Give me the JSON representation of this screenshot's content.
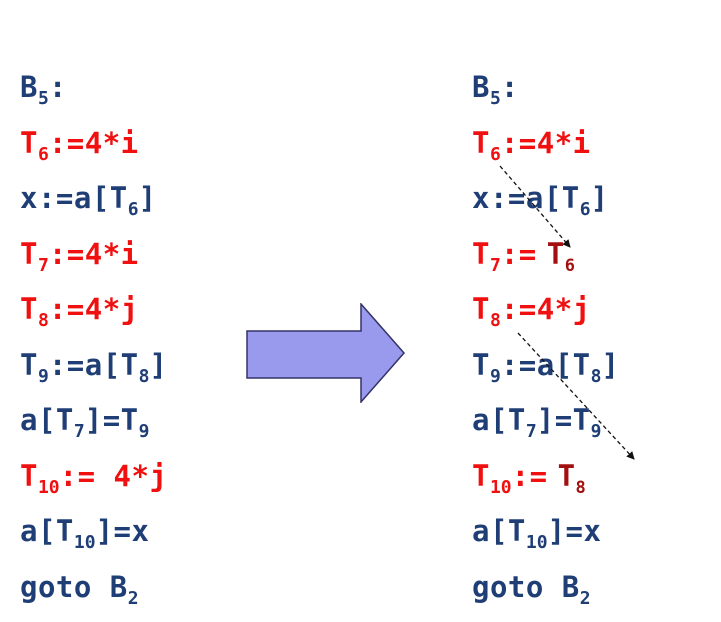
{
  "before": {
    "block_label": {
      "text": "B",
      "sub": "5",
      "suffix": ":"
    },
    "lines": [
      {
        "color": "red",
        "parts": [
          {
            "t": "T"
          },
          {
            "s": "6"
          },
          {
            "t": ":=4*i"
          }
        ]
      },
      {
        "color": "blue",
        "parts": [
          {
            "t": "x:=a[T"
          },
          {
            "s": "6"
          },
          {
            "t": "]"
          }
        ]
      },
      {
        "color": "red",
        "parts": [
          {
            "t": "T"
          },
          {
            "s": "7"
          },
          {
            "t": ":=4*i"
          }
        ]
      },
      {
        "color": "red",
        "parts": [
          {
            "t": "T"
          },
          {
            "s": "8"
          },
          {
            "t": ":=4*j"
          }
        ]
      },
      {
        "color": "blue",
        "parts": [
          {
            "t": "T"
          },
          {
            "s": "9"
          },
          {
            "t": ":=a[T"
          },
          {
            "s": "8"
          },
          {
            "t": "]"
          }
        ]
      },
      {
        "color": "blue",
        "parts": [
          {
            "t": "a[T"
          },
          {
            "s": "7"
          },
          {
            "t": "]=T"
          },
          {
            "s": "9"
          }
        ]
      },
      {
        "color": "red",
        "parts": [
          {
            "t": "T"
          },
          {
            "s": "10"
          },
          {
            "t": ":= 4*j"
          }
        ]
      },
      {
        "color": "blue",
        "parts": [
          {
            "t": "a[T"
          },
          {
            "s": "10"
          },
          {
            "t": "]=x"
          }
        ]
      },
      {
        "color": "blue",
        "parts": [
          {
            "t": "goto B"
          },
          {
            "s": "2"
          }
        ]
      }
    ]
  },
  "after": {
    "block_label": {
      "text": "B",
      "sub": "5",
      "suffix": ":"
    },
    "lines": [
      {
        "color": "red",
        "parts": [
          {
            "t": "T"
          },
          {
            "s": "6"
          },
          {
            "t": ":=4*i"
          }
        ]
      },
      {
        "color": "blue",
        "parts": [
          {
            "t": "x:=a[T"
          },
          {
            "s": "6"
          },
          {
            "t": "]"
          }
        ]
      },
      {
        "color": "red",
        "parts": [
          {
            "t": "T"
          },
          {
            "s": "7"
          },
          {
            "t": ":="
          }
        ],
        "replacement": {
          "text": "T",
          "sub": "6"
        }
      },
      {
        "color": "red",
        "parts": [
          {
            "t": "T"
          },
          {
            "s": "8"
          },
          {
            "t": ":=4*j"
          }
        ]
      },
      {
        "color": "blue",
        "parts": [
          {
            "t": "T"
          },
          {
            "s": "9"
          },
          {
            "t": ":=a[T"
          },
          {
            "s": "8"
          },
          {
            "t": "]"
          }
        ]
      },
      {
        "color": "blue",
        "parts": [
          {
            "t": "a[T"
          },
          {
            "s": "7"
          },
          {
            "t": "]=T"
          },
          {
            "s": "9"
          }
        ]
      },
      {
        "color": "red",
        "parts": [
          {
            "t": "T"
          },
          {
            "s": "10"
          },
          {
            "t": ":="
          }
        ],
        "replacement": {
          "text": "T",
          "sub": "8"
        }
      },
      {
        "color": "blue",
        "parts": [
          {
            "t": "a[T"
          },
          {
            "s": "10"
          },
          {
            "t": "]=x"
          }
        ]
      },
      {
        "color": "blue",
        "parts": [
          {
            "t": "goto B"
          },
          {
            "s": "2"
          }
        ]
      }
    ]
  },
  "arrow": {
    "icon": "block-right-arrow",
    "fill": "#9999ee",
    "stroke": "#333366"
  },
  "colors": {
    "blue": "#1f3e76",
    "red": "#f01010",
    "dark_red": "#a31010"
  }
}
